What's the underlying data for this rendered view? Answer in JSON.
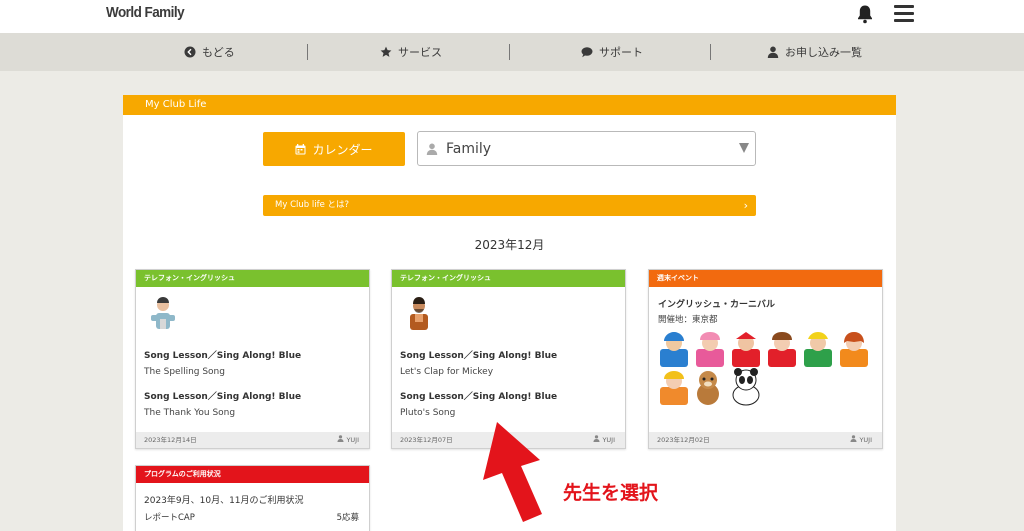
{
  "header": {
    "logo_text": "World Family",
    "icons": [
      "bell-icon",
      "hamburger-menu-icon"
    ]
  },
  "nav": {
    "items": [
      {
        "label": "もどる",
        "icon": "back-arrow-circle-icon"
      },
      {
        "label": "サービス",
        "icon": "star-icon"
      },
      {
        "label": "サポート",
        "icon": "chat-bubble-icon"
      },
      {
        "label": "お申し込み一覧",
        "icon": "person-icon"
      }
    ]
  },
  "panel": {
    "title": "My Club Life",
    "calendar_button": "カレンダー",
    "profile_select": "Family",
    "about_link": "My Club life とは?",
    "month": "2023年12月"
  },
  "cards": [
    {
      "category": "テレフォン・イングリッシュ",
      "color": "#7ac12e",
      "lessons": [
        {
          "title": "Song Lesson／Sing Along! Blue",
          "song": "The Spelling Song"
        },
        {
          "title": "Song Lesson／Sing Along! Blue",
          "song": "The Thank You Song"
        }
      ],
      "date": "2023年12月14日",
      "teacher": "YUJI"
    },
    {
      "category": "テレフォン・イングリッシュ",
      "color": "#7ac12e",
      "lessons": [
        {
          "title": "Song Lesson／Sing Along! Blue",
          "song": "Let's Clap for Mickey"
        },
        {
          "title": "Song Lesson／Sing Along! Blue",
          "song": "Pluto's Song"
        }
      ],
      "date": "2023年12月07日",
      "teacher": "YUJI"
    },
    {
      "category": "週末イベント",
      "color": "#f26a0f",
      "event_title": "イングリッシュ・カーニバル",
      "location": "開催地：東京都",
      "date": "2023年12月02日",
      "teacher": "YUJI"
    }
  ],
  "program": {
    "header": "プログラムのご利用状況",
    "color": "#e3141b",
    "period": "2023年9月、10月、11月のご利用状況",
    "item_label": "レポートCAP",
    "item_count": "5応募"
  },
  "callout": {
    "text": "先生を選択",
    "color": "#e3141b"
  },
  "colors": {
    "accent": "#f7a800",
    "background": "#ecebe6",
    "nav": "#dddcd6",
    "progress": "#14b7e7"
  }
}
